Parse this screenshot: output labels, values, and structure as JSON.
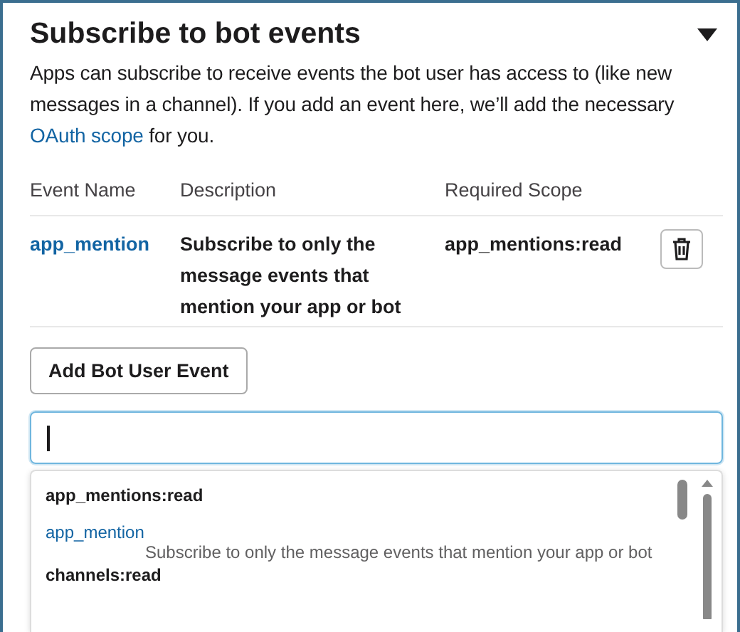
{
  "section": {
    "title": "Subscribe to bot events",
    "expanded": true,
    "description": "Apps can subscribe to receive events the bot user has access to (like new messages in a channel). If you add an event here, we’ll add the necessary",
    "link": "OAuth scope",
    "description_end": "for you."
  },
  "table": {
    "columns": [
      "Event Name",
      "Description",
      "Required Scope"
    ],
    "rows": [
      {
        "event_name": "app_mention",
        "description": "Subscribe to only the message events that mention your app or bot",
        "required_scope": "app_mentions:read"
      }
    ]
  },
  "add_button": "Add Bot User Event",
  "search": {
    "focused": true
  },
  "dropdown": {
    "groups": [
      {
        "heading": "app_mentions:read",
        "items": [
          {
            "name": "app_mention",
            "description": "Subscribe to only the message events that mention your app or bot"
          }
        ]
      },
      {
        "heading": "channels:read"
      }
    ]
  }
}
